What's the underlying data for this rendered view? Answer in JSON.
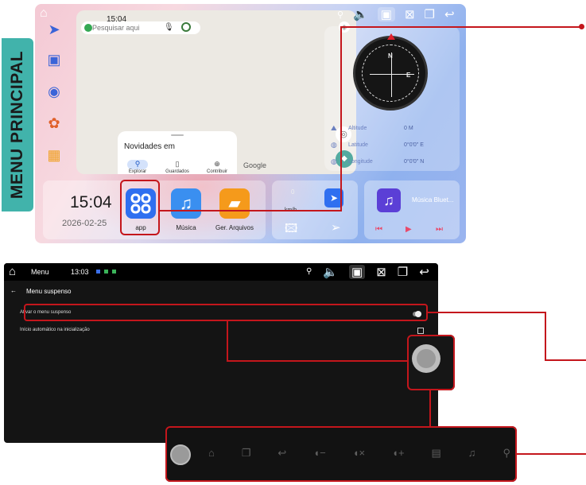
{
  "side_label": "MENU PRINCIPAL",
  "top_screen": {
    "status_time": "15:04",
    "search_placeholder": "Pesquisar aqui",
    "news_title": "Novidades em",
    "news_tabs": [
      "Explorar",
      "Guardados",
      "Contribuir"
    ],
    "google_logo": "Google",
    "compass": {
      "directions": [
        "N",
        "E"
      ],
      "rows": [
        {
          "label": "Altitude",
          "value": "0 M"
        },
        {
          "label": "Latitude",
          "value": "0°0'0\" E"
        },
        {
          "label": "Longitude",
          "value": "0°0'0\" N"
        }
      ]
    },
    "clock_time": "15:04",
    "clock_date": "2026-02-25",
    "apps": [
      {
        "label": "app",
        "icon": "app-grid-icon",
        "color": "#2f6ff0"
      },
      {
        "label": "Música",
        "icon": "music-note-icon",
        "color": "#3a8ff0"
      },
      {
        "label": "Ger. Arquivos",
        "icon": "folder-icon",
        "color": "#f59a1b"
      }
    ],
    "speed": {
      "value": "0",
      "unit": "km/h"
    },
    "music_player": {
      "title": "Música Bluet..."
    }
  },
  "bottom_screen": {
    "title": "Menu",
    "status_time": "13:03",
    "subtitle": "Menu suspenso",
    "settings": [
      {
        "label": "Ativar o menu suspenso",
        "control": "toggle",
        "value": false
      },
      {
        "label": "Início automático na inicialização",
        "control": "checkbox",
        "value": false
      }
    ],
    "float_dock_icons": [
      "home-icon",
      "recent-apps-icon",
      "back-icon",
      "volume-down-icon",
      "mute-icon",
      "volume-up-icon",
      "radio-icon",
      "music-note-icon",
      "location-icon"
    ]
  },
  "colors": {
    "accent_red": "#c4161c",
    "teal_label": "#41b3ab"
  }
}
